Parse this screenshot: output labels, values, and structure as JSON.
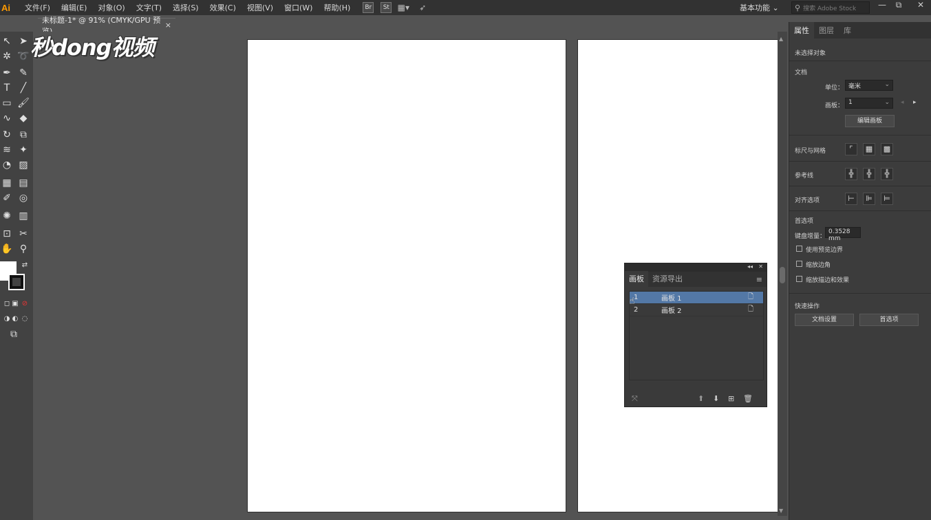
{
  "app": {
    "logo": "Ai"
  },
  "menu": [
    "文件(F)",
    "编辑(E)",
    "对象(O)",
    "文字(T)",
    "选择(S)",
    "效果(C)",
    "视图(V)",
    "窗口(W)",
    "帮助(H)"
  ],
  "menubar_icons": {
    "bridge": "Br",
    "stock": "St",
    "arrange": "arrange-documents-icon",
    "rocket": "gpu-performance-icon"
  },
  "workspace": {
    "label": "基本功能"
  },
  "search": {
    "placeholder": "搜索 Adobe Stock"
  },
  "window_controls": {
    "minimize": "—",
    "restore": "⧉",
    "close": "✕"
  },
  "document_tab": {
    "title": "未标题-1* @ 91% (CMYK/GPU 预览)",
    "close": "×"
  },
  "watermark": {
    "text": "秒dong视频"
  },
  "artboard_panel": {
    "tabs": [
      "画板",
      "资源导出"
    ],
    "rows": [
      {
        "num": "1",
        "name": "画板 1",
        "selected": true
      },
      {
        "num": "2",
        "name": "画板 2",
        "selected": false
      }
    ]
  },
  "properties": {
    "tabs": [
      "属性",
      "图层",
      "库"
    ],
    "no_selection": "未选择对象",
    "document_section": "文档",
    "units_label": "单位：",
    "units_value": "毫米",
    "artboard_label": "画板：",
    "artboard_value": "1",
    "edit_artboards": "编辑画板",
    "rulers_grids": "标尺与网格",
    "guides": "参考线",
    "snap_options": "对齐选项",
    "preferences_section": "首选项",
    "keyboard_increment_label": "键盘增量：",
    "keyboard_increment_value": "0.3528 mm",
    "use_preview_bounds": "使用预览边界",
    "scale_corners": "缩放边角",
    "scale_strokes_effects": "缩放描边和效果",
    "quick_actions": "快速操作",
    "document_setup": "文档设置",
    "preferences_button": "首选项"
  }
}
